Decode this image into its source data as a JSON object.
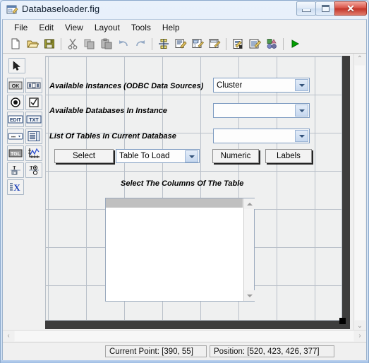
{
  "window": {
    "title": "Databaseloader.fig",
    "icon": "figure-editor-icon",
    "minimize_label": "Minimize",
    "maximize_label": "Maximize",
    "close_label": "Close"
  },
  "menubar": {
    "items": [
      {
        "label": "File"
      },
      {
        "label": "Edit"
      },
      {
        "label": "View"
      },
      {
        "label": "Layout"
      },
      {
        "label": "Tools"
      },
      {
        "label": "Help"
      }
    ]
  },
  "toolbar": {
    "buttons": [
      {
        "name": "new-file-icon",
        "tooltip": "New"
      },
      {
        "name": "open-folder-icon",
        "tooltip": "Open"
      },
      {
        "name": "save-disk-icon",
        "tooltip": "Save"
      },
      {
        "name": "cut-scissors-icon",
        "tooltip": "Cut"
      },
      {
        "name": "copy-pages-icon",
        "tooltip": "Copy"
      },
      {
        "name": "paste-clipboard-icon",
        "tooltip": "Paste"
      },
      {
        "name": "undo-arrow-icon",
        "tooltip": "Undo"
      },
      {
        "name": "redo-arrow-icon",
        "tooltip": "Redo"
      },
      {
        "name": "align-objects-icon",
        "tooltip": "Align Objects"
      },
      {
        "name": "menu-editor-icon",
        "tooltip": "Menu Editor"
      },
      {
        "name": "tab-order-editor-icon",
        "tooltip": "Tab Order Editor"
      },
      {
        "name": "toolbar-editor-icon",
        "tooltip": "Toolbar Editor"
      },
      {
        "name": "m-file-editor-icon",
        "tooltip": "M-file Editor"
      },
      {
        "name": "property-inspector-icon",
        "tooltip": "Property Inspector"
      },
      {
        "name": "object-browser-icon",
        "tooltip": "Object Browser"
      },
      {
        "name": "run-figure-icon",
        "tooltip": "Run"
      }
    ]
  },
  "palette": {
    "tools": [
      {
        "name": "select-arrow-tool",
        "label": "Select"
      },
      {
        "name": "push-button-tool",
        "label": "OK"
      },
      {
        "name": "slider-tool",
        "label": "Slider"
      },
      {
        "name": "radio-button-tool",
        "label": "Radio Button"
      },
      {
        "name": "check-box-tool",
        "label": "Check Box"
      },
      {
        "name": "edit-text-tool",
        "label": "EDIT"
      },
      {
        "name": "static-text-tool",
        "label": "TXT"
      },
      {
        "name": "pop-up-menu-tool",
        "label": "Pop-up Menu"
      },
      {
        "name": "list-box-tool",
        "label": "List Box"
      },
      {
        "name": "toggle-button-tool",
        "label": "TGL"
      },
      {
        "name": "axes-tool",
        "label": "Axes"
      },
      {
        "name": "panel-tool",
        "label": "Panel"
      },
      {
        "name": "button-group-tool",
        "label": "Button Group"
      },
      {
        "name": "activex-control-tool",
        "label": "X"
      }
    ]
  },
  "canvas": {
    "labels": {
      "available_instances": "Available Instances (ODBC Data Sources)",
      "available_databases": "Available Databases In Instance",
      "list_of_tables": "List Of Tables In Current Database",
      "select_columns": "Select The Columns Of The Table"
    },
    "combos": {
      "instances": {
        "value": "Cluster",
        "placeholder": ""
      },
      "databases": {
        "value": "",
        "placeholder": ""
      },
      "tables": {
        "value": "",
        "placeholder": ""
      },
      "table_to_load": {
        "value": "Table To Load",
        "placeholder": ""
      }
    },
    "buttons": {
      "select": "Select",
      "numeric": "Numeric",
      "labels": "Labels"
    },
    "listbox": {
      "items": [],
      "selected_index": 0
    }
  },
  "statusbar": {
    "current_point": "Current Point:  [390, 55]",
    "position": "Position: [520, 423, 426, 377]"
  },
  "colors": {
    "title_bar": "#dfeaf8",
    "close_button": "#c23529",
    "canvas_bg": "#eff0f0",
    "grid_line": "#b9c0c9",
    "canvas_shadow": "#3d3d3d",
    "combo_border": "#7d9bc1",
    "combo_arrow": "#c6d8ef",
    "listbox_selection": "#c0c0c0",
    "run_arrow": "#00a000"
  }
}
